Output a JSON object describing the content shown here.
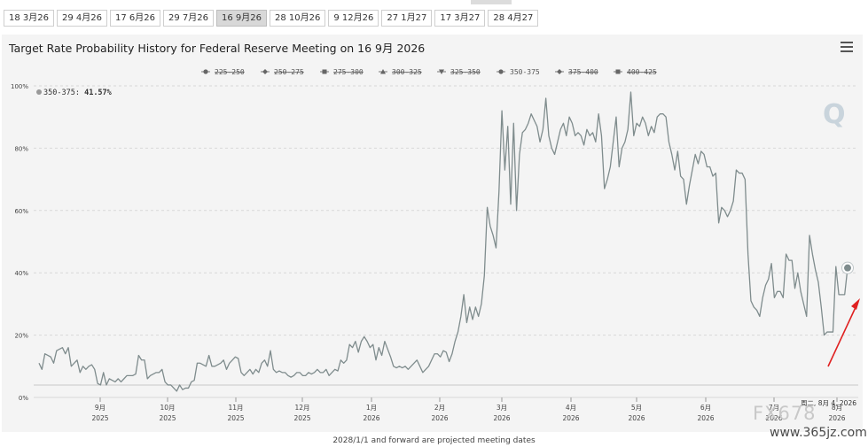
{
  "tabs": [
    {
      "label": "18 3月26",
      "active": false
    },
    {
      "label": "29 4月26",
      "active": false
    },
    {
      "label": "17 6月26",
      "active": false
    },
    {
      "label": "29 7月26",
      "active": false
    },
    {
      "label": "16 9月26",
      "active": true
    },
    {
      "label": "28 10月26",
      "active": false
    },
    {
      "label": "9 12月26",
      "active": false
    },
    {
      "label": "27 1月27",
      "active": false
    },
    {
      "label": "17 3月27",
      "active": false
    },
    {
      "label": "28 4月27",
      "active": false
    }
  ],
  "footnote": "2028/1/1 and forward are projected meeting dates",
  "watermarks": {
    "corner": "Q",
    "brand": "FX678",
    "url": "www.365jz.com"
  },
  "colors": {
    "series": "#7f8c8d",
    "arrow": "#e02020",
    "grid": "#d8d8d8",
    "panel": "#f4f4f4"
  },
  "chart_data": {
    "type": "line",
    "title": "Target Rate Probability History for Federal Reserve Meeting on 16 9月 2026",
    "legend_position": "top-center",
    "legend": [
      {
        "name": "225-250",
        "marker": "circle",
        "hidden": true
      },
      {
        "name": "250-275",
        "marker": "diamond",
        "hidden": true
      },
      {
        "name": "275-300",
        "marker": "square",
        "hidden": true
      },
      {
        "name": "300-325",
        "marker": "triangle",
        "hidden": true
      },
      {
        "name": "325-350",
        "marker": "triangle-down",
        "hidden": true
      },
      {
        "name": "350-375",
        "marker": "circle",
        "hidden": false
      },
      {
        "name": "375-400",
        "marker": "diamond",
        "hidden": true
      },
      {
        "name": "400-425",
        "marker": "square",
        "hidden": true
      }
    ],
    "tooltip": {
      "series": "350-375",
      "text": "41.57%"
    },
    "hover_label": [
      "周二, 8月 4, 2026"
    ],
    "y_ticks": [
      "0%",
      "20%",
      "40%",
      "60%",
      "80%",
      "100%"
    ],
    "ylim": [
      0,
      100
    ],
    "grid": true,
    "x_ticks": [
      {
        "label": "9月",
        "year": "2025"
      },
      {
        "label": "10月",
        "year": "2025"
      },
      {
        "label": "11月",
        "year": "2025"
      },
      {
        "label": "12月",
        "year": "2025"
      },
      {
        "label": "1月",
        "year": "2026"
      },
      {
        "label": "2月",
        "year": "2026"
      },
      {
        "label": "3月",
        "year": "2026"
      },
      {
        "label": "4月",
        "year": "2026"
      },
      {
        "label": "5月",
        "year": "2026"
      },
      {
        "label": "6月",
        "year": "2026"
      },
      {
        "label": "7月",
        "year": "2026"
      },
      {
        "label": "8月",
        "year": "2026"
      }
    ],
    "series": [
      {
        "name": "350-375",
        "values": [
          11,
          9,
          14,
          13.5,
          13,
          11,
          15,
          15.5,
          16,
          14,
          16,
          10,
          11,
          12,
          8,
          10,
          9,
          10,
          10.5,
          9,
          4.5,
          4,
          8,
          4,
          6,
          5.5,
          5,
          6,
          5,
          6,
          7,
          7,
          7,
          7.5,
          13.5,
          12,
          12,
          6,
          7,
          7.5,
          8,
          8,
          9,
          5,
          4,
          4,
          3,
          2,
          4,
          2.5,
          3,
          3,
          5,
          5.5,
          11,
          11,
          10.5,
          10,
          13.5,
          10,
          10,
          10.5,
          11,
          12,
          9,
          11,
          12,
          13,
          12.5,
          8,
          7,
          8,
          9,
          7.5,
          9,
          8,
          11,
          12,
          10,
          15,
          9,
          8,
          8.5,
          8,
          8,
          7,
          6.5,
          7,
          8,
          8,
          7,
          7,
          8,
          7.5,
          8,
          9,
          8,
          8,
          9,
          7,
          8,
          9,
          8.5,
          12,
          11,
          12,
          17,
          16,
          18,
          14.5,
          18,
          19.5,
          18,
          16,
          17,
          12,
          16,
          13.5,
          18,
          15.5,
          13,
          10,
          9.5,
          10,
          9.5,
          10,
          9,
          10,
          11,
          12,
          10,
          8,
          9,
          10,
          12,
          14,
          14,
          13,
          15,
          14.5,
          11.5,
          14,
          18,
          21,
          26,
          33,
          24,
          29,
          25,
          29,
          26,
          30,
          39,
          61,
          55,
          52,
          48,
          66,
          92,
          73,
          87,
          62,
          88,
          60,
          78,
          85,
          86,
          88,
          91,
          89,
          87,
          82,
          86,
          96,
          84,
          80,
          78,
          82,
          86,
          88,
          84,
          90,
          88,
          84,
          85,
          84,
          81,
          86,
          84,
          85,
          82,
          91,
          84,
          67,
          70,
          74,
          82,
          90,
          74,
          80,
          82,
          86,
          98,
          84,
          88,
          87,
          90,
          88,
          84,
          87,
          85,
          90,
          91,
          91,
          90,
          82,
          78,
          73,
          79,
          71,
          70,
          62,
          68,
          73,
          78,
          75,
          79,
          78,
          74,
          74,
          71,
          72,
          56,
          61,
          60,
          58,
          60,
          63,
          73,
          72,
          72,
          70,
          46,
          31,
          29,
          28,
          26,
          32,
          36,
          38,
          43,
          32,
          34,
          34,
          32,
          46,
          44,
          44,
          35,
          40,
          34,
          30,
          26,
          52,
          46,
          41,
          37,
          29,
          20,
          21,
          21,
          21,
          42,
          33,
          33,
          33,
          41.57
        ]
      }
    ]
  }
}
